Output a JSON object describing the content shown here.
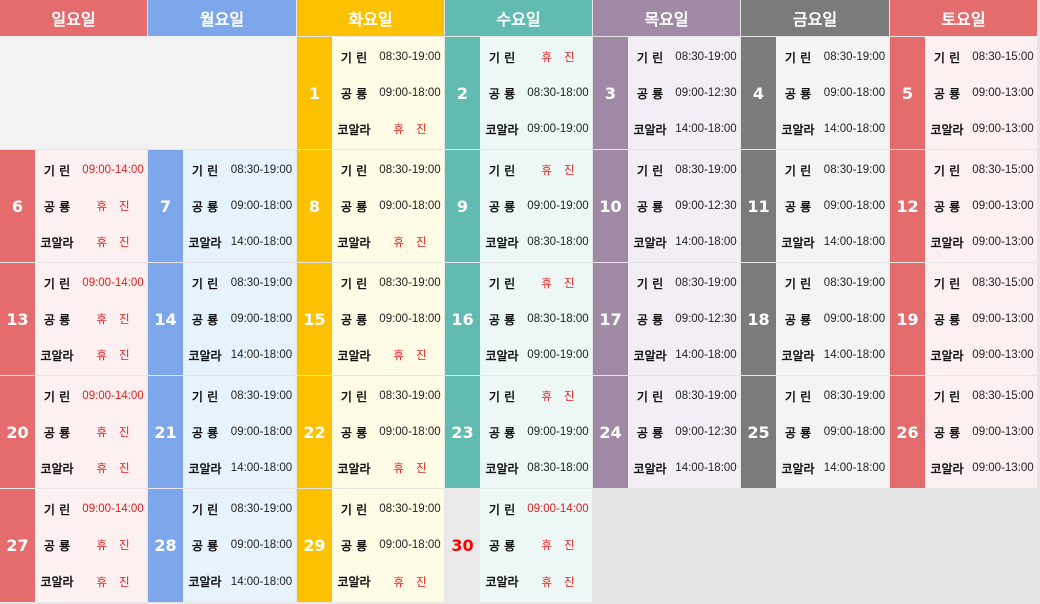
{
  "headers": [
    "일요일",
    "월요일",
    "화요일",
    "수요일",
    "목요일",
    "금요일",
    "토요일"
  ],
  "names": [
    "기 린",
    "공 룡",
    "코알라"
  ],
  "closed_label": "휴진",
  "weeks": [
    [
      null,
      null,
      {
        "day": "1",
        "v": [
          "08:30-19:00",
          "09:00-18:00",
          "휴진"
        ]
      },
      {
        "day": "2",
        "v": [
          "휴진",
          "08:30-18:00",
          "09:00-19:00"
        ]
      },
      {
        "day": "3",
        "v": [
          "08:30-19:00",
          "09:00-12:30",
          "14:00-18:00"
        ]
      },
      {
        "day": "4",
        "v": [
          "08:30-19:00",
          "09:00-18:00",
          "14:00-18:00"
        ]
      },
      {
        "day": "5",
        "v": [
          "08:30-15:00",
          "09:00-13:00",
          "09:00-13:00"
        ]
      }
    ],
    [
      {
        "day": "6",
        "v": [
          "09:00-14:00",
          "휴진",
          "휴진"
        ]
      },
      {
        "day": "7",
        "v": [
          "08:30-19:00",
          "09:00-18:00",
          "14:00-18:00"
        ]
      },
      {
        "day": "8",
        "v": [
          "08:30-19:00",
          "09:00-18:00",
          "휴진"
        ]
      },
      {
        "day": "9",
        "v": [
          "휴진",
          "09:00-19:00",
          "08:30-18:00"
        ]
      },
      {
        "day": "10",
        "v": [
          "08:30-19:00",
          "09:00-12:30",
          "14:00-18:00"
        ]
      },
      {
        "day": "11",
        "v": [
          "08:30-19:00",
          "09:00-18:00",
          "14:00-18:00"
        ]
      },
      {
        "day": "12",
        "v": [
          "08:30-15:00",
          "09:00-13:00",
          "09:00-13:00"
        ]
      }
    ],
    [
      {
        "day": "13",
        "v": [
          "09:00-14:00",
          "휴진",
          "휴진"
        ]
      },
      {
        "day": "14",
        "v": [
          "08:30-19:00",
          "09:00-18:00",
          "14:00-18:00"
        ]
      },
      {
        "day": "15",
        "v": [
          "08:30-19:00",
          "09:00-18:00",
          "휴진"
        ]
      },
      {
        "day": "16",
        "v": [
          "휴진",
          "08:30-18:00",
          "09:00-19:00"
        ]
      },
      {
        "day": "17",
        "v": [
          "08:30-19:00",
          "09:00-12:30",
          "14:00-18:00"
        ]
      },
      {
        "day": "18",
        "v": [
          "08:30-19:00",
          "09:00-18:00",
          "14:00-18:00"
        ]
      },
      {
        "day": "19",
        "v": [
          "08:30-15:00",
          "09:00-13:00",
          "09:00-13:00"
        ]
      }
    ],
    [
      {
        "day": "20",
        "v": [
          "09:00-14:00",
          "휴진",
          "휴진"
        ]
      },
      {
        "day": "21",
        "v": [
          "08:30-19:00",
          "09:00-18:00",
          "14:00-18:00"
        ]
      },
      {
        "day": "22",
        "v": [
          "08:30-19:00",
          "09:00-18:00",
          "휴진"
        ]
      },
      {
        "day": "23",
        "v": [
          "휴진",
          "09:00-19:00",
          "08:30-18:00"
        ]
      },
      {
        "day": "24",
        "v": [
          "08:30-19:00",
          "09:00-12:30",
          "14:00-18:00"
        ]
      },
      {
        "day": "25",
        "v": [
          "08:30-19:00",
          "09:00-18:00",
          "14:00-18:00"
        ]
      },
      {
        "day": "26",
        "v": [
          "08:30-15:00",
          "09:00-13:00",
          "09:00-13:00"
        ]
      }
    ],
    [
      {
        "day": "27",
        "v": [
          "09:00-14:00",
          "휴진",
          "휴진"
        ]
      },
      {
        "day": "28",
        "v": [
          "08:30-19:00",
          "09:00-18:00",
          "14:00-18:00"
        ]
      },
      {
        "day": "29",
        "v": [
          "08:30-19:00",
          "09:00-18:00",
          "휴진"
        ]
      },
      {
        "day": "30",
        "holiday": true,
        "v": [
          "09:00-14:00",
          "휴진",
          "휴진"
        ]
      },
      null,
      null,
      null
    ]
  ],
  "colors": {
    "sun": {
      "header": "#e46c6c",
      "num": "#e46c6c",
      "bg": "#fdf0f0"
    },
    "mon": {
      "header": "#7da7ea",
      "num": "#7da7ea",
      "bg": "#e6f3fd"
    },
    "tue": {
      "header": "#fcc100",
      "num": "#fcc100",
      "bg": "#fffbe5"
    },
    "wed": {
      "header": "#62bbb1",
      "num": "#62bbb1",
      "bg": "#edf7f6"
    },
    "thu": {
      "header": "#a08aa6",
      "num": "#a08aa6",
      "bg": "#f3eef6"
    },
    "fri": {
      "header": "#7b7b7b",
      "num": "#7b7b7b",
      "bg": "#f4f4f4"
    },
    "sat": {
      "header": "#e46c6c",
      "num": "#e46c6c",
      "bg": "#fdf0f0"
    },
    "closed_text": "#e02020"
  }
}
